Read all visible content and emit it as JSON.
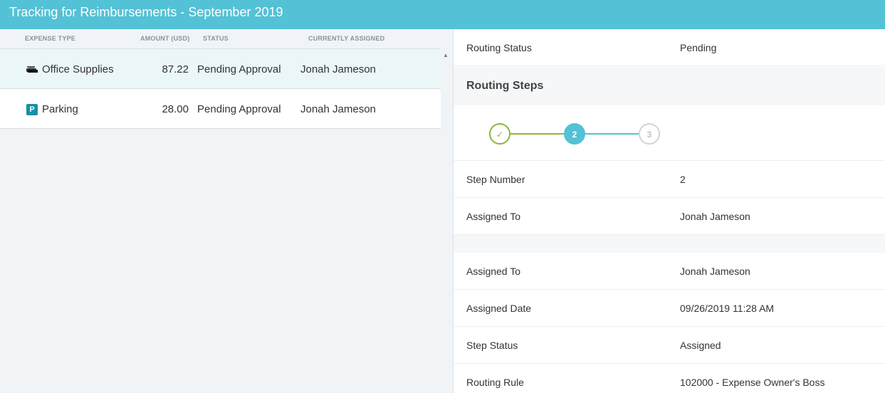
{
  "header": {
    "title": "Tracking for Reimbursements - September 2019"
  },
  "table": {
    "columns": [
      "EXPENSE TYPE",
      "AMOUNT (USD)",
      "STATUS",
      "CURRENTLY ASSIGNED"
    ],
    "rows": [
      {
        "icon": "printer-icon",
        "type": "Office Supplies",
        "amount": "87.22",
        "status": "Pending Approval",
        "assigned": "Jonah Jameson"
      },
      {
        "icon": "parking-icon",
        "icon_text": "P",
        "type": "Parking",
        "amount": "28.00",
        "status": "Pending Approval",
        "assigned": "Jonah Jameson"
      }
    ]
  },
  "detail": {
    "routing_status_label": "Routing Status",
    "routing_status_value": "Pending",
    "routing_steps_title": "Routing Steps",
    "steps": [
      {
        "state": "done",
        "label": "✓"
      },
      {
        "state": "current",
        "label": "2"
      },
      {
        "state": "todo",
        "label": "3"
      }
    ],
    "step_number_label": "Step Number",
    "step_number_value": "2",
    "assigned_to_label": "Assigned To",
    "assigned_to_value": "Jonah Jameson",
    "assigned_to_label_2": "Assigned To",
    "assigned_to_value_2": "Jonah Jameson",
    "assigned_date_label": "Assigned Date",
    "assigned_date_value": "09/26/2019 11:28 AM",
    "step_status_label": "Step Status",
    "step_status_value": "Assigned",
    "routing_rule_label": "Routing Rule",
    "routing_rule_value": "102000 - Expense Owner's Boss"
  },
  "colors": {
    "accent": "#53c1d6",
    "done": "#8cb43c",
    "todo": "#d0d4d7"
  }
}
